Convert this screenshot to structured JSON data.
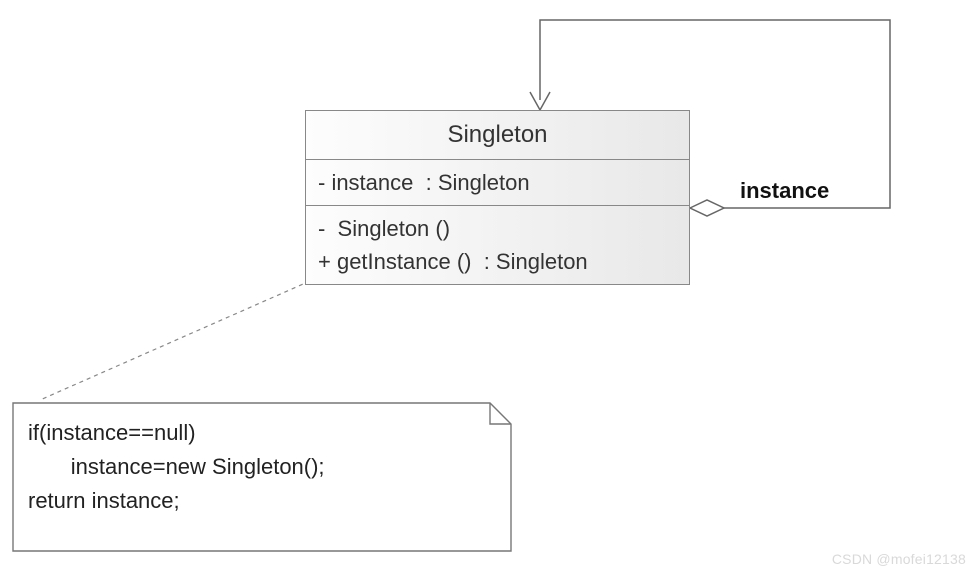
{
  "class": {
    "name": "Singleton",
    "attributes": [
      "- instance  : Singleton"
    ],
    "operations": [
      "-  Singleton ()",
      "+ getInstance ()  : Singleton"
    ]
  },
  "association": {
    "label": "instance"
  },
  "note": {
    "lines": [
      "if(instance==null)",
      "       instance=new Singleton();",
      "return instance;"
    ]
  },
  "watermark": "CSDN @mofei12138"
}
